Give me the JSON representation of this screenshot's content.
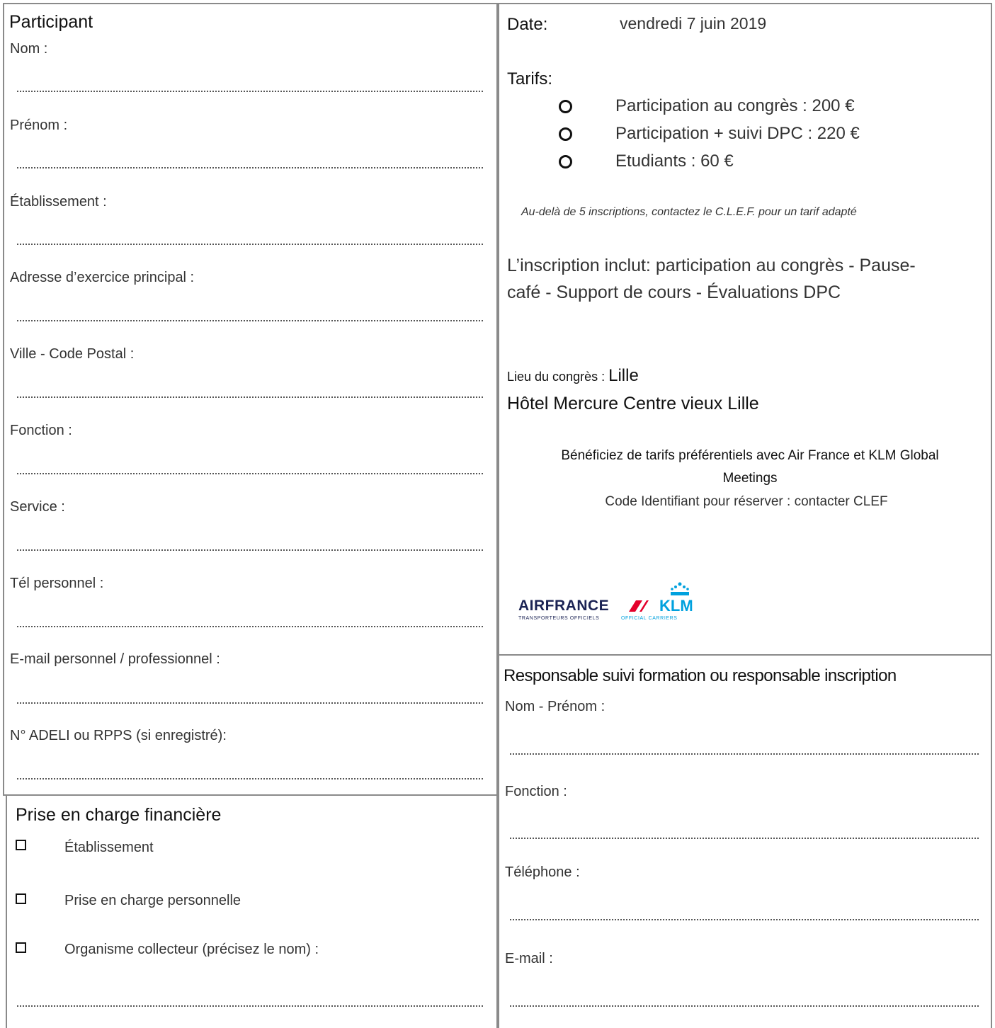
{
  "participant": {
    "title": "Participant",
    "fields": [
      {
        "label": "Nom :"
      },
      {
        "label": "Prénom :"
      },
      {
        "label": "Établissement :"
      },
      {
        "label": "Adresse d’exercice principal :"
      },
      {
        "label": "Ville - Code Postal :"
      },
      {
        "label": "Fonction :"
      },
      {
        "label": "Service :"
      },
      {
        "label": "Tél personnel :"
      },
      {
        "label": "E-mail personnel / professionnel :"
      },
      {
        "label": "N° ADELI ou RPPS (si enregistré):"
      }
    ]
  },
  "financement": {
    "title": "Prise en charge financière",
    "options": [
      {
        "label": "Établissement",
        "checked": false
      },
      {
        "label": "Prise en charge personnelle",
        "checked": false
      },
      {
        "label": "Organisme collecteur (précisez le nom) :",
        "checked": false
      }
    ]
  },
  "info": {
    "date_label": "Date:",
    "date_value": "vendredi 7 juin 2019",
    "tarifs_title": "Tarifs:",
    "tarifs": [
      {
        "label": "Participation au congrès : 200 €",
        "selected": false
      },
      {
        "label": "Participation + suivi DPC : 220 €",
        "selected": false
      },
      {
        "label": "Etudiants : 60 €",
        "selected": false
      }
    ],
    "note": "Au-delà de 5 inscriptions, contactez le C.L.E.F. pour un tarif adapté",
    "inclut_line1": "L’inscription inclut: participation au congrès - Pause-",
    "inclut_line2": "café - Support de cours - Évaluations DPC",
    "lieu_label": "Lieu du congrès : ",
    "lieu_city": "Lille",
    "hotel": "Hôtel  Mercure Centre vieux Lille",
    "promo_line1": "Bénéficiez de tarifs préférentiels avec Air France et KLM Global",
    "promo_line2": "Meetings",
    "code_line": "Code Identifiant pour réserver : contacter CLEF",
    "logo": {
      "airfrance": "AIRFRANCE",
      "klm": "KLM",
      "sub_left": "TRANSPORTEURS OFFICIELS",
      "sub_right": "OFFICIAL CARRIERS",
      "color_af": "#1b2354",
      "color_klm": "#00a1de",
      "color_stripe": "#e4002b"
    }
  },
  "responsable": {
    "title": "Responsable suivi formation ou responsable inscription",
    "fields": [
      {
        "label": "Nom - Prénom :"
      },
      {
        "label": "Fonction :"
      },
      {
        "label": "Téléphone :"
      },
      {
        "label": "E-mail :"
      }
    ]
  }
}
